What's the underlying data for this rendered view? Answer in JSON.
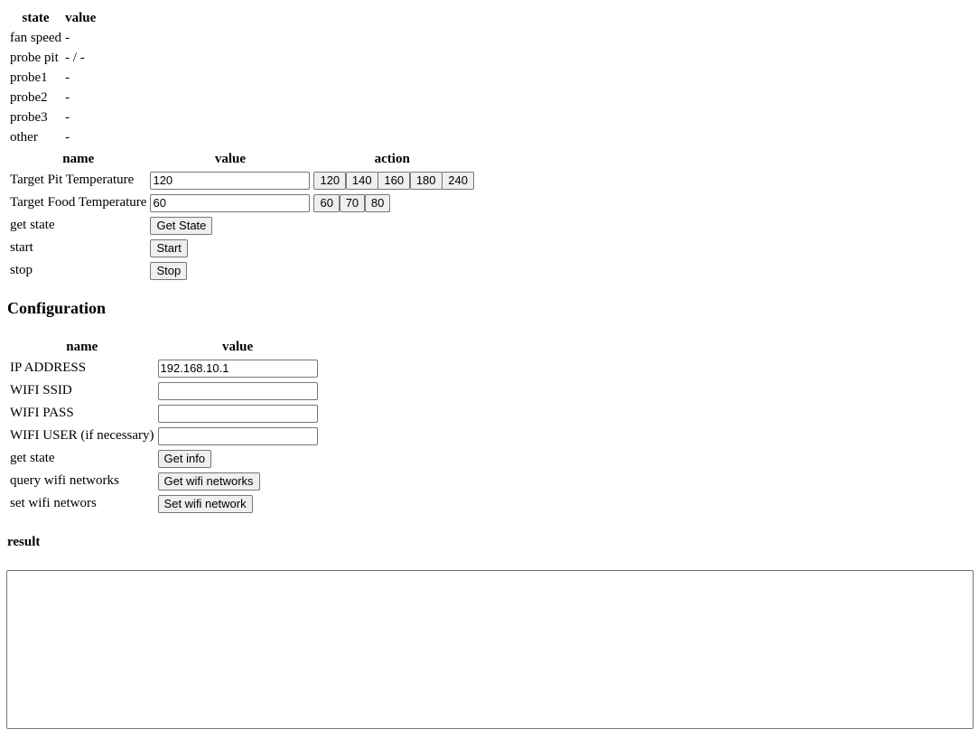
{
  "state_table": {
    "headers": [
      "state",
      "value"
    ],
    "rows": [
      {
        "state": "fan speed",
        "value": "-"
      },
      {
        "state": "probe pit",
        "value": "- / -"
      },
      {
        "state": "probe1",
        "value": "-"
      },
      {
        "state": "probe2",
        "value": "-"
      },
      {
        "state": "probe3",
        "value": "-"
      },
      {
        "state": "other",
        "value": "-"
      }
    ]
  },
  "control_table": {
    "headers": [
      "name",
      "value",
      "action"
    ],
    "pit": {
      "label": "Target Pit Temperature",
      "value": "120",
      "presets": [
        "120",
        "140",
        "160",
        "180",
        "240"
      ]
    },
    "food": {
      "label": "Target Food Temperature",
      "value": "60",
      "presets": [
        "60",
        "70",
        "80"
      ]
    },
    "get_state": {
      "label": "get state",
      "button": "Get State"
    },
    "start": {
      "label": "start",
      "button": "Start"
    },
    "stop": {
      "label": "stop",
      "button": "Stop"
    }
  },
  "configuration": {
    "title": "Configuration",
    "headers": [
      "name",
      "value"
    ],
    "ip": {
      "label": "IP ADDRESS",
      "value": "192.168.10.1"
    },
    "ssid": {
      "label": "WIFI SSID",
      "value": ""
    },
    "pass": {
      "label": "WIFI PASS",
      "value": ""
    },
    "user": {
      "label": "WIFI USER (if necessary)",
      "value": ""
    },
    "get_info": {
      "label": "get state",
      "button": "Get info"
    },
    "query_wifi": {
      "label": "query wifi networks",
      "button": "Get wifi networks"
    },
    "set_wifi": {
      "label": "set wifi networs",
      "button": "Set wifi network"
    }
  },
  "result": {
    "title": "result",
    "value": ""
  }
}
